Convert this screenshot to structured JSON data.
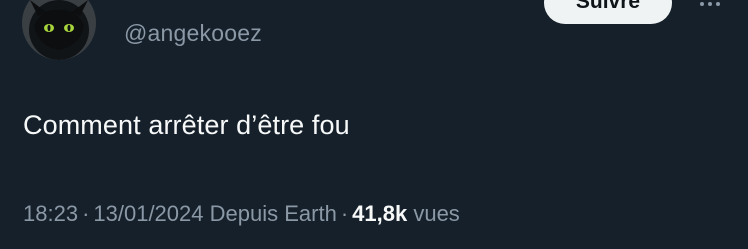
{
  "tweet": {
    "handle": "@angekooez",
    "follow_label": "Suivre",
    "text": "Comment arrêter d’être fou",
    "time": "18:23",
    "date": "13/01/2024",
    "source": "Depuis Earth",
    "views_count": "41,8k",
    "views_label": "vues",
    "separator": "·"
  },
  "icons": {
    "avatar": "dark-dragon-avatar",
    "more": "more-options-icon"
  },
  "colors": {
    "background": "#15202b",
    "primary_text": "#f7f9f9",
    "secondary_text": "#8b98a5",
    "button_bg": "#eff3f4"
  }
}
